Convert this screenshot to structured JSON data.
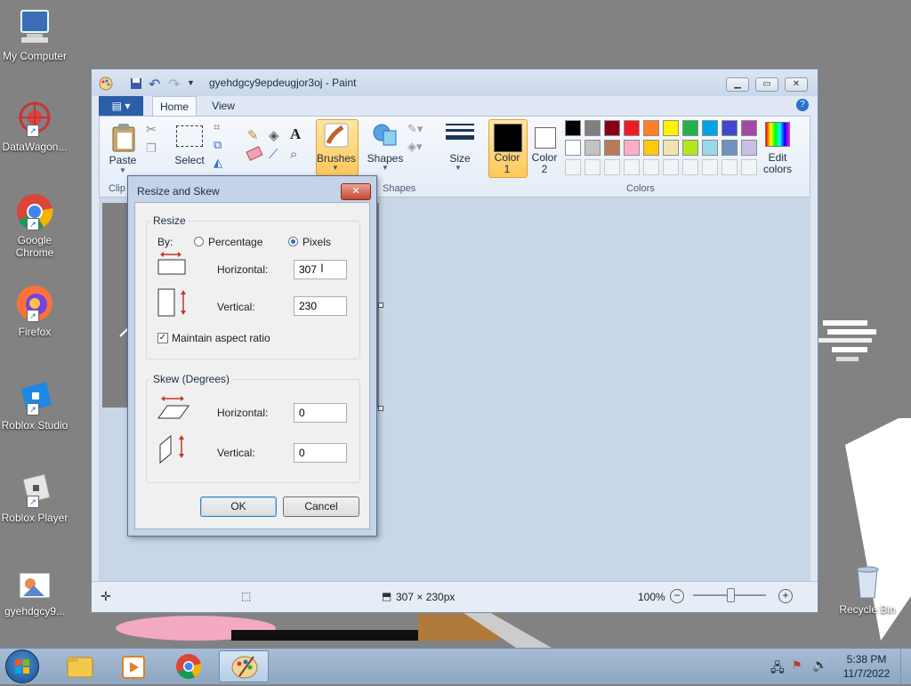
{
  "desktop": {
    "icons": [
      {
        "label": "My Computer",
        "name": "my-computer"
      },
      {
        "label": "DataWagon...",
        "name": "datawagon"
      },
      {
        "label": "Google Chrome",
        "name": "google-chrome"
      },
      {
        "label": "Firefox",
        "name": "firefox"
      },
      {
        "label": "Roblox Studio",
        "name": "roblox-studio"
      },
      {
        "label": "Roblox Player",
        "name": "roblox-player"
      },
      {
        "label": "gyehdgcy9...",
        "name": "image-file"
      }
    ],
    "recycle_bin_label": "Recycle Bin"
  },
  "paint": {
    "title": "gyehdgcy9epdeugjor3oj - Paint",
    "tabs": {
      "home": "Home",
      "view": "View"
    },
    "ribbon": {
      "paste": "Paste",
      "clipboard_group": "Clip",
      "select": "Select",
      "brushes": "Brushes",
      "shapes": "Shapes",
      "shapes_group": "Shapes",
      "size": "Size",
      "color1": "Color 1",
      "color2": "Color 2",
      "edit_colors": "Edit colors",
      "colors_group": "Colors"
    },
    "palette_row1": [
      "#000000",
      "#7f7f7f",
      "#880015",
      "#ed1c24",
      "#ff7f27",
      "#fff200",
      "#22b14c",
      "#00a2e8",
      "#3f48cc",
      "#a349a4"
    ],
    "palette_row2": [
      "#ffffff",
      "#c3c3c3",
      "#b97a57",
      "#ffaec9",
      "#ffc90e",
      "#efe4b0",
      "#b5e61d",
      "#99d9ea",
      "#7092be",
      "#c8bfe7"
    ],
    "color1_value": "#000000",
    "color2_value": "#ffffff",
    "status": {
      "image_size": "307 × 230px",
      "zoom": "100%"
    }
  },
  "dialog": {
    "title": "Resize and Skew",
    "resize_group": "Resize",
    "by_label": "By:",
    "percentage": "Percentage",
    "pixels": "Pixels",
    "horizontal_label": "Horizontal:",
    "vertical_label": "Vertical:",
    "resize_horizontal": "307",
    "resize_vertical": "230",
    "maintain_aspect": "Maintain aspect ratio",
    "skew_group": "Skew (Degrees)",
    "skew_horizontal": "0",
    "skew_vertical": "0",
    "ok": "OK",
    "cancel": "Cancel"
  },
  "taskbar": {
    "time": "5:38 PM",
    "date": "11/7/2022"
  }
}
